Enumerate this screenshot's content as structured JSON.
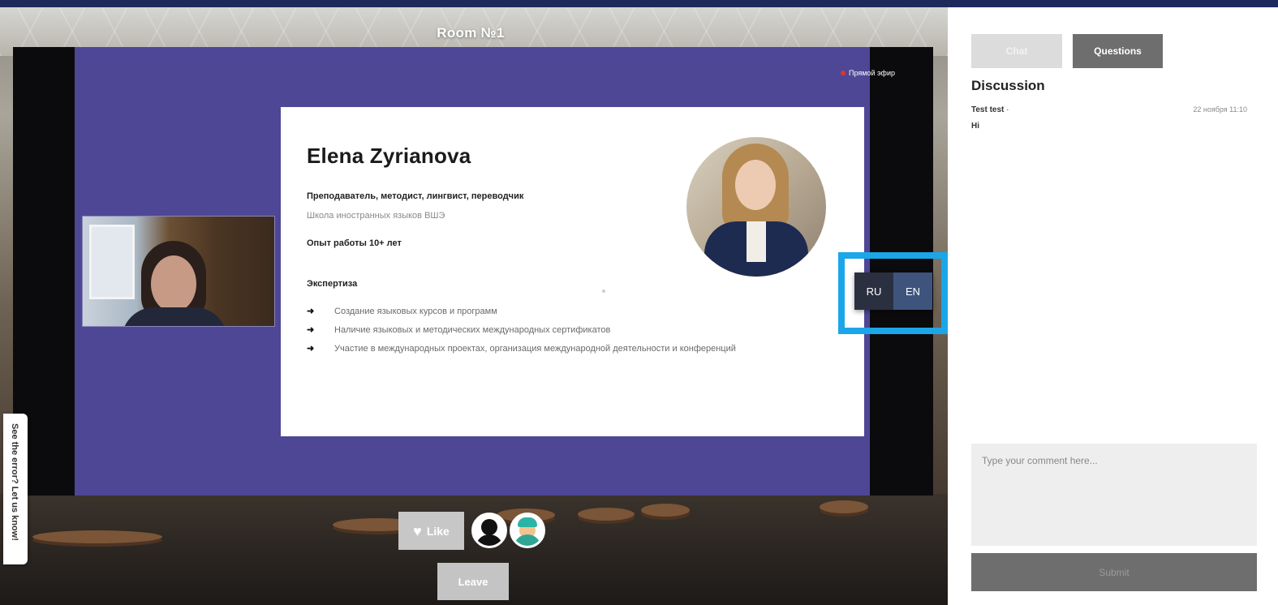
{
  "room": {
    "title": "Room №1"
  },
  "slide": {
    "live_label": "Прямой эфир",
    "speaker_name": "Elena Zyrianova",
    "role": "Преподаватель, методист, лингвист, переводчик",
    "organization": "Школа иностранных языков ВШЭ",
    "experience": "Опыт работы 10+ лет",
    "expertise_heading": "Экспертиза",
    "expertise_items": [
      {
        "arrow": "➜",
        "text": "Создание языковых курсов и программ"
      },
      {
        "arrow": "➜",
        "text": "Наличие языковых и методических международных сертификатов"
      },
      {
        "arrow": "➜",
        "text": "Участие в международных проектах, организация международной деятельности и конференций"
      }
    ]
  },
  "language_toggle": {
    "options": [
      "RU",
      "EN"
    ],
    "selected": "EN"
  },
  "feedback": {
    "label": "See the error? Let us know!"
  },
  "controls": {
    "like_icon": "♥",
    "like_label": "Like",
    "leave_label": "Leave"
  },
  "panel": {
    "tabs": [
      "Chat",
      "Questions"
    ],
    "active_tab": "Questions",
    "heading": "Discussion",
    "messages": [
      {
        "author": "Test test",
        "separator": "·",
        "time": "22 ноября 11:10",
        "text": "Hi"
      }
    ],
    "input_placeholder": "Type your comment here...",
    "send_label": "Submit"
  },
  "colors": {
    "slide_background": "#4e4796",
    "highlight_frame": "#1aa6e8",
    "active_tab": "#6e6e6e"
  }
}
